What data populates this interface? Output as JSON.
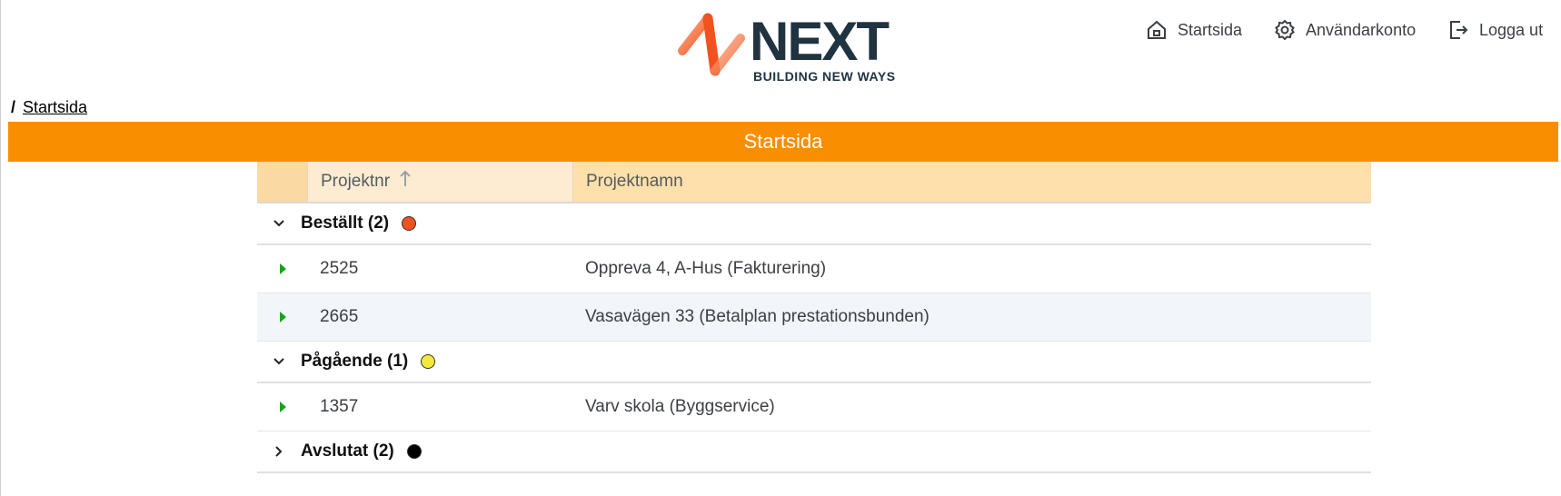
{
  "brand": {
    "word": "NEXT",
    "tagline": "BUILDING NEW WAYS"
  },
  "nav": {
    "home": "Startsida",
    "account": "Användarkonto",
    "logout": "Logga ut"
  },
  "breadcrumb": {
    "separator": "/",
    "current": "Startsida"
  },
  "page_title": "Startsida",
  "table": {
    "columns": {
      "project_nr": "Projektnr",
      "project_name": "Projektnamn"
    },
    "groups": [
      {
        "label": "Beställt (2)",
        "color": "#f0531f",
        "expanded": true,
        "rows": [
          {
            "nr": "2525",
            "name": "Oppreva 4, A-Hus (Fakturering)"
          },
          {
            "nr": "2665",
            "name": "Vasavägen 33 (Betalplan prestationsbunden)"
          }
        ]
      },
      {
        "label": "Pågående (1)",
        "color": "#f2ea3a",
        "expanded": true,
        "rows": [
          {
            "nr": "1357",
            "name": "Varv skola (Byggservice)"
          }
        ]
      },
      {
        "label": "Avslutat (2)",
        "color": "#000000",
        "expanded": false,
        "rows": []
      }
    ]
  },
  "colors": {
    "accent": "#f98e00",
    "expand_arrow": "#1aa31a"
  }
}
